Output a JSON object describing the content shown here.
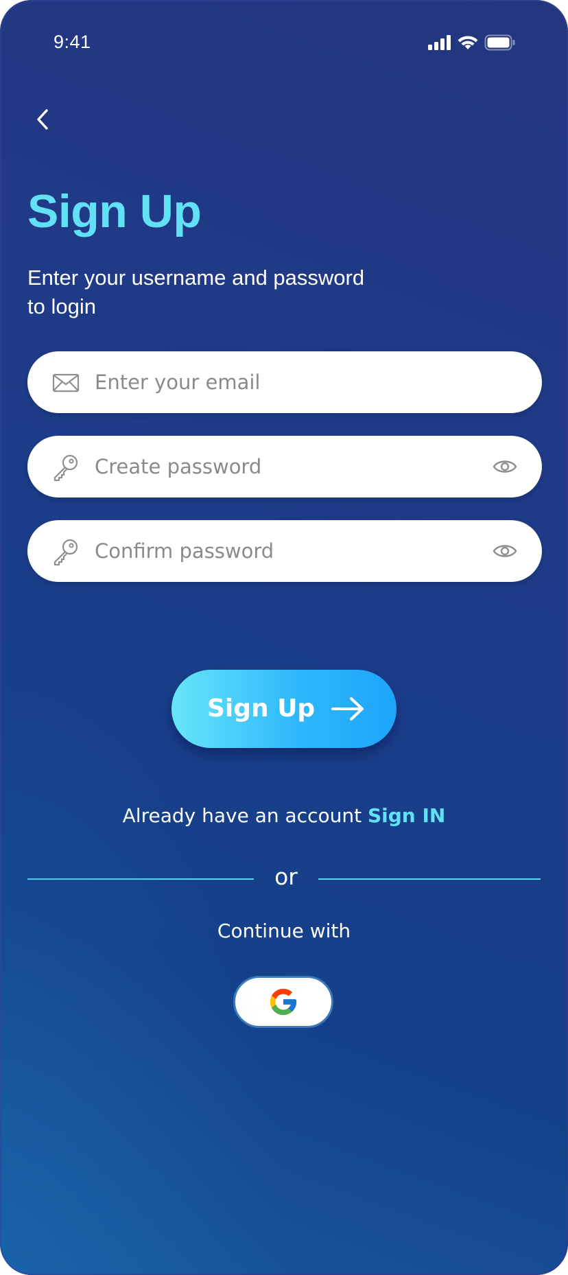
{
  "status_bar": {
    "time": "9:41",
    "icons": [
      "cellular-signal-icon",
      "wifi-icon",
      "battery-icon"
    ]
  },
  "header": {
    "back_icon": "chevron-left-icon",
    "title": "Sign Up",
    "subtitle_line1": "Enter your username and password",
    "subtitle_line2": "to login"
  },
  "form": {
    "email": {
      "icon": "envelope-icon",
      "placeholder": "Enter your email",
      "value": ""
    },
    "password": {
      "icon": "key-icon",
      "placeholder": "Create password",
      "value": "",
      "toggle_icon": "eye-icon"
    },
    "confirm_password": {
      "icon": "key-icon",
      "placeholder": "Confirm password",
      "value": "",
      "toggle_icon": "eye-icon"
    }
  },
  "actions": {
    "signup_label": "Sign Up",
    "signup_icon": "arrow-right-icon",
    "signin_prompt": "Already have an account",
    "signin_link": "Sign IN",
    "divider_text": "or",
    "continue_text": "Continue with",
    "google_icon": "google-logo-icon"
  },
  "colors": {
    "accent": "#62e0f5",
    "background_top": "#24357f",
    "background_bottom": "#175a9f",
    "button_gradient_start": "#66e6f7",
    "button_gradient_end": "#1ea4fa"
  }
}
